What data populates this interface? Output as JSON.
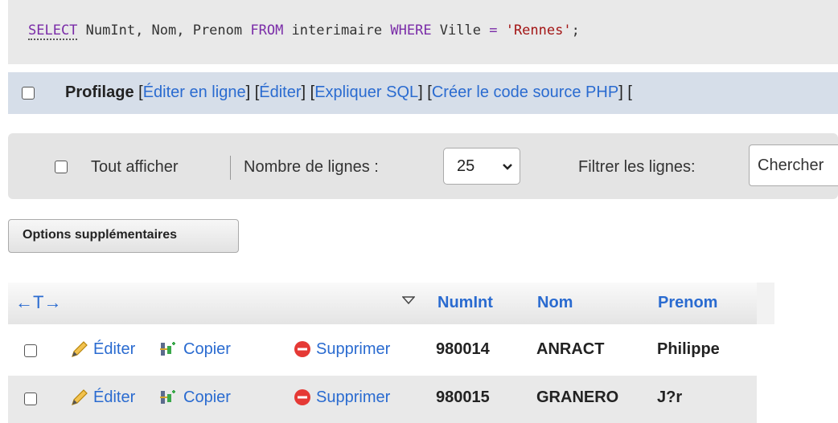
{
  "sql": {
    "select_kw": "SELECT",
    "columns": " NumInt, Nom, Prenom ",
    "from_kw": "FROM",
    "table": " interimaire ",
    "where_kw": "WHERE",
    "field": " Ville ",
    "op": "=",
    "value": " 'Rennes'",
    "end": ";"
  },
  "profiling": {
    "label": "Profilage",
    "open": "[",
    "close": "]",
    "links": [
      "Éditer en ligne",
      "Éditer",
      "Expliquer SQL",
      "Créer le code source PHP"
    ]
  },
  "nav": {
    "show_all": "Tout afficher",
    "rows_label": "Nombre de lignes :",
    "rows_value": "25",
    "filter_label": "Filtrer les lignes:",
    "search_placeholder": "Chercher"
  },
  "options_button": "Options supplémentaires",
  "table": {
    "arrows": "←T→",
    "headers": [
      "NumInt",
      "Nom",
      "Prenom"
    ],
    "actions": {
      "edit": "Éditer",
      "copy": "Copier",
      "delete": "Supprimer"
    },
    "rows": [
      {
        "numint": "980014",
        "nom": "ANRACT",
        "prenom": "Philippe"
      },
      {
        "numint": "980015",
        "nom": "GRANERO",
        "prenom": "J?r"
      }
    ]
  },
  "colors": {
    "link": "#2a6bd0",
    "keyword": "#7a2ca8",
    "string": "#a31515",
    "delete_icon": "#e53935"
  },
  "icons": [
    "pencil-icon",
    "copy-icon",
    "delete-icon",
    "sort-down-icon",
    "chevron-down-icon"
  ]
}
